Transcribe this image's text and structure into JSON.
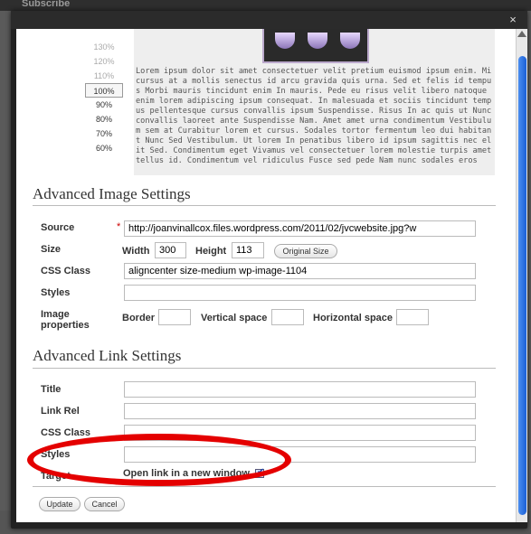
{
  "background": {
    "subscribe_label": "Subscribe"
  },
  "modal": {
    "close_glyph": "×"
  },
  "preview": {
    "zoom_levels": [
      "130%",
      "120%",
      "110%",
      "100%",
      "90%",
      "80%",
      "70%",
      "60%"
    ],
    "selected_zoom": "100%",
    "sample_text": "Lorem ipsum dolor sit amet consectetuer velit pretium euismod ipsum enim. Mi cursus at a mollis senectus id arcu gravida quis urna. Sed et felis id tempus Morbi mauris tincidunt enim In mauris. Pede eu risus velit libero natoque enim lorem adipiscing ipsum consequat. In malesuada et sociis tincidunt tempus pellentesque cursus convallis ipsum Suspendisse. Risus In ac quis ut Nunc convallis laoreet ante Suspendisse Nam. Amet amet urna condimentum Vestibulum sem at Curabitur lorem et cursus. Sodales tortor fermentum leo dui habitant Nunc Sed Vestibulum. Ut lorem In penatibus libero id ipsum sagittis nec elit Sed. Condimentum eget Vivamus vel consectetuer lorem molestie turpis amet tellus id. Condimentum vel ridiculus Fusce sed pede Nam nunc sodales eros"
  },
  "image_settings": {
    "title": "Advanced Image Settings",
    "source_label": "Source",
    "required_marker": "*",
    "source_value": "http://joanvinallcox.files.wordpress.com/2011/02/jvcwebsite.jpg?w",
    "size_label": "Size",
    "width_label": "Width",
    "width_value": "300",
    "height_label": "Height",
    "height_value": "113",
    "original_size_button": "Original Size",
    "css_class_label": "CSS Class",
    "css_class_value": "aligncenter size-medium wp-image-1104",
    "styles_label": "Styles",
    "styles_value": "",
    "image_properties_label_1": "Image",
    "image_properties_label_2": "properties",
    "border_label": "Border",
    "border_value": "",
    "vertical_space_label": "Vertical space",
    "vertical_space_value": "",
    "horizontal_space_label": "Horizontal space",
    "horizontal_space_value": ""
  },
  "link_settings": {
    "title": "Advanced Link Settings",
    "title_label": "Title",
    "title_value": "",
    "link_rel_label": "Link Rel",
    "link_rel_value": "",
    "css_class_label": "CSS Class",
    "css_class_value": "",
    "styles_label": "Styles",
    "styles_value": "",
    "target_label": "Target",
    "open_new_window_label": "Open link in a new window",
    "open_new_window_checked": true
  },
  "actions": {
    "update": "Update",
    "cancel": "Cancel"
  },
  "colors": {
    "highlight_ellipse": "#e40000",
    "scroll_thumb": "#1a5fd6"
  }
}
